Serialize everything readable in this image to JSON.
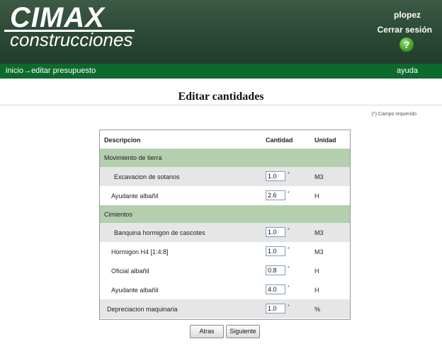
{
  "header": {
    "logo_title": "CIMAX",
    "logo_subtitle": "construcciones",
    "username": "plopez",
    "logout_label": "Cerrar sesión",
    "help_icon": "?"
  },
  "nav": {
    "breadcrumb": "inicio→editar presupuesto",
    "help_label": "ayuda"
  },
  "page": {
    "title": "Editar cantidades",
    "required_note": "(*) Campo requerido"
  },
  "table": {
    "columns": {
      "description": "Descripcion",
      "quantity": "Cantidad",
      "unit": "Unidad"
    },
    "groups": [
      {
        "label": "Movimiento de tierra"
      },
      {
        "label": "Cimientos"
      }
    ],
    "items": [
      {
        "description": "Excavacion de sotanos",
        "quantity": "1.0",
        "required": "*",
        "unit": "M3"
      },
      {
        "description": "Ayudante albañil",
        "quantity": "2.6",
        "required": "*",
        "unit": "H"
      },
      {
        "description": "Banquina hormigon de cascotes",
        "quantity": "1.0",
        "required": "*",
        "unit": "M3"
      },
      {
        "description": "Hormigon H4 [1:4:8]",
        "quantity": "1.0",
        "required": "*",
        "unit": "M3"
      },
      {
        "description": "Oficial albañil",
        "quantity": "0.8",
        "required": "*",
        "unit": "H"
      },
      {
        "description": "Ayudante albañil",
        "quantity": "4.0",
        "required": "*",
        "unit": "H"
      },
      {
        "description": "Depreciacion maquinaria",
        "quantity": "1.0",
        "required": "*",
        "unit": "%"
      }
    ]
  },
  "buttons": {
    "back": "Atras",
    "next": "Siguiente"
  },
  "colors": {
    "header_bg": "#2f4d3a",
    "nav_bg": "#0c6a2c",
    "group_row_bg": "#b3cfae",
    "shaded_row_bg": "#e6e6e6"
  }
}
